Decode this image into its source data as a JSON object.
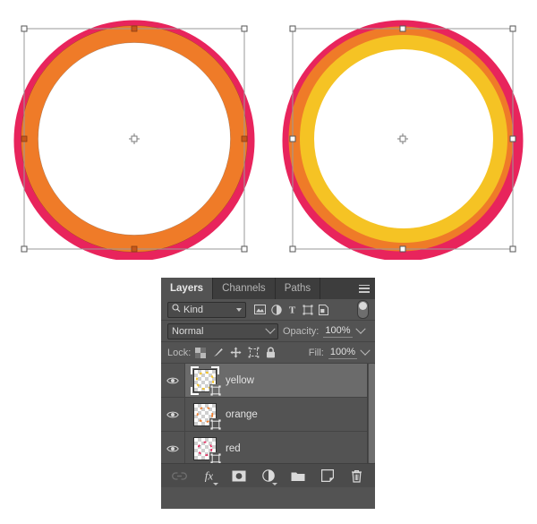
{
  "artwork": {
    "left": {
      "name": "two-ring-circle",
      "rings": [
        {
          "name": "red-ring",
          "color": "#E8245C"
        },
        {
          "name": "orange-ring",
          "color": "#EF7B28"
        }
      ],
      "transform_box": {
        "visible": true,
        "handles": 8,
        "reference_point": "center"
      }
    },
    "right": {
      "name": "three-ring-circle",
      "rings": [
        {
          "name": "red-ring",
          "color": "#E8245C"
        },
        {
          "name": "orange-ring",
          "color": "#EF7B28"
        },
        {
          "name": "yellow-ring",
          "color": "#F5C324"
        }
      ],
      "transform_box": {
        "visible": true,
        "handles": 8,
        "reference_point": "center"
      }
    }
  },
  "panel": {
    "tabs": [
      {
        "label": "Layers",
        "active": true
      },
      {
        "label": "Channels",
        "active": false
      },
      {
        "label": "Paths",
        "active": false
      }
    ],
    "menu_icon": "hamburger-menu-icon",
    "filter_row": {
      "search_icon": "magnifier-icon",
      "kind_label": "Kind",
      "icons": [
        "pixel-layer-filter-icon",
        "adjustment-layer-filter-icon",
        "type-layer-filter-icon",
        "shape-layer-filter-icon",
        "smart-object-filter-icon"
      ],
      "toggle": "filter-enable-toggle"
    },
    "blend_row": {
      "blend_mode": "Normal",
      "opacity_label": "Opacity:",
      "opacity_value": "100%"
    },
    "lock_row": {
      "lock_label": "Lock:",
      "icons": [
        "lock-transparent-pixels-icon",
        "lock-image-pixels-icon",
        "lock-position-icon",
        "lock-artboard-nesting-icon",
        "lock-all-icon"
      ],
      "fill_label": "Fill:",
      "fill_value": "100%"
    },
    "layers": [
      {
        "name": "yellow",
        "visible": true,
        "selected": true,
        "thumb_color": "#F5C324"
      },
      {
        "name": "orange",
        "visible": true,
        "selected": false,
        "thumb_color": "#EF7B28"
      },
      {
        "name": "red",
        "visible": true,
        "selected": false,
        "thumb_color": "#E8245C"
      }
    ],
    "footer_buttons": [
      {
        "name": "link-layers-button",
        "icon": "link-icon",
        "disabled": true
      },
      {
        "name": "layer-style-button",
        "icon": "fx-icon",
        "disabled": false
      },
      {
        "name": "layer-mask-button",
        "icon": "mask-icon",
        "disabled": false
      },
      {
        "name": "adjustment-layer-button",
        "icon": "adjustment-icon",
        "disabled": false
      },
      {
        "name": "new-group-button",
        "icon": "folder-icon",
        "disabled": false
      },
      {
        "name": "new-layer-button",
        "icon": "new-layer-icon",
        "disabled": false
      },
      {
        "name": "delete-layer-button",
        "icon": "trash-icon",
        "disabled": false
      }
    ]
  },
  "colors": {
    "panel_bg": "#535353",
    "panel_header": "#3d3d3d",
    "selected_layer": "#6b6b6b",
    "text": "#d6d6d6",
    "red": "#E8245C",
    "orange": "#EF7B28",
    "yellow": "#F5C324"
  }
}
